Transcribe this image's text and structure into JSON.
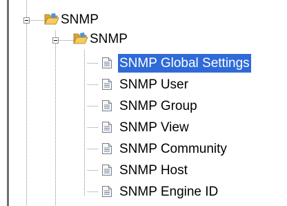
{
  "tree": {
    "root": {
      "label": "SNMP",
      "icon": "open-folder-icon",
      "expanded": true
    },
    "child": {
      "label": "SNMP",
      "icon": "open-folder-icon",
      "expanded": true
    },
    "items": [
      {
        "label": "SNMP Global Settings",
        "icon": "document-icon",
        "selected": true
      },
      {
        "label": "SNMP User",
        "icon": "document-icon",
        "selected": false
      },
      {
        "label": "SNMP Group",
        "icon": "document-icon",
        "selected": false
      },
      {
        "label": "SNMP View",
        "icon": "document-icon",
        "selected": false
      },
      {
        "label": "SNMP Community",
        "icon": "document-icon",
        "selected": false
      },
      {
        "label": "SNMP Host",
        "icon": "document-icon",
        "selected": false
      },
      {
        "label": "SNMP Engine ID",
        "icon": "document-icon",
        "selected": false
      }
    ]
  },
  "colors": {
    "selection": "#2f6ad8",
    "selection_text": "#ffffff"
  }
}
